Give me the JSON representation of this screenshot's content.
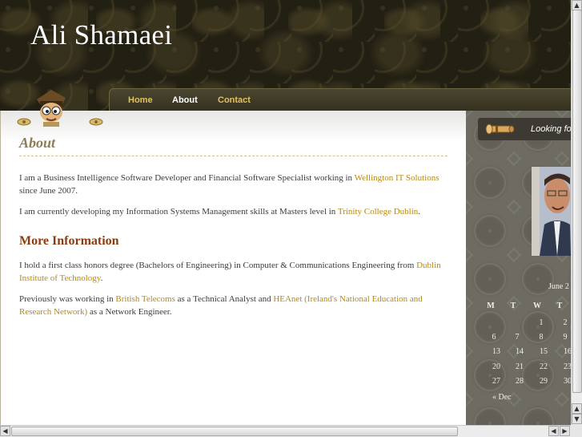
{
  "header": {
    "site_title": "Ali Shamaei"
  },
  "nav": {
    "items": [
      {
        "label": "Home",
        "active": false
      },
      {
        "label": "About",
        "active": true
      },
      {
        "label": "Contact",
        "active": false
      }
    ]
  },
  "page": {
    "title": "About",
    "para1": {
      "before": "I am a Business Intelligence Software Developer and Financial Software Specialist working in ",
      "link": "Wellington IT Solutions",
      "after": " since June 2007."
    },
    "para2": {
      "before": "I am currently developing my Information Systems Management skills at Masters level in ",
      "link": "Trinity College Dublin",
      "after": "."
    },
    "section_title": "More Information",
    "para3": {
      "before": "I hold a first class honors degree (Bachelors of Engineering) in Computer & Communications Engineering from ",
      "link": "Dublin Institute of Technology",
      "after": "."
    },
    "para4": {
      "before": "Previously was working in ",
      "link1": "British Telecoms",
      "middle": " as a Technical Analyst and ",
      "link2": "HEAnet (Ireland's National Education and Research Network)",
      "after": " as a Network Engineer."
    }
  },
  "sidebar": {
    "banner_text": "Looking fo",
    "calendar": {
      "caption": "June 2",
      "headers": [
        "M",
        "T",
        "W",
        "T"
      ],
      "rows": [
        [
          "",
          "",
          "1",
          "2"
        ],
        [
          "6",
          "7",
          "8",
          "9"
        ],
        [
          "13",
          "14",
          "15",
          "16"
        ],
        [
          "20",
          "21",
          "22",
          "23"
        ],
        [
          "27",
          "28",
          "29",
          "30"
        ]
      ],
      "prev_link": "« Dec"
    }
  },
  "colors": {
    "link": "#b88a10",
    "nav_link": "#e2c25c",
    "section_title": "#8a3c12",
    "page_title": "#8f7c54"
  }
}
